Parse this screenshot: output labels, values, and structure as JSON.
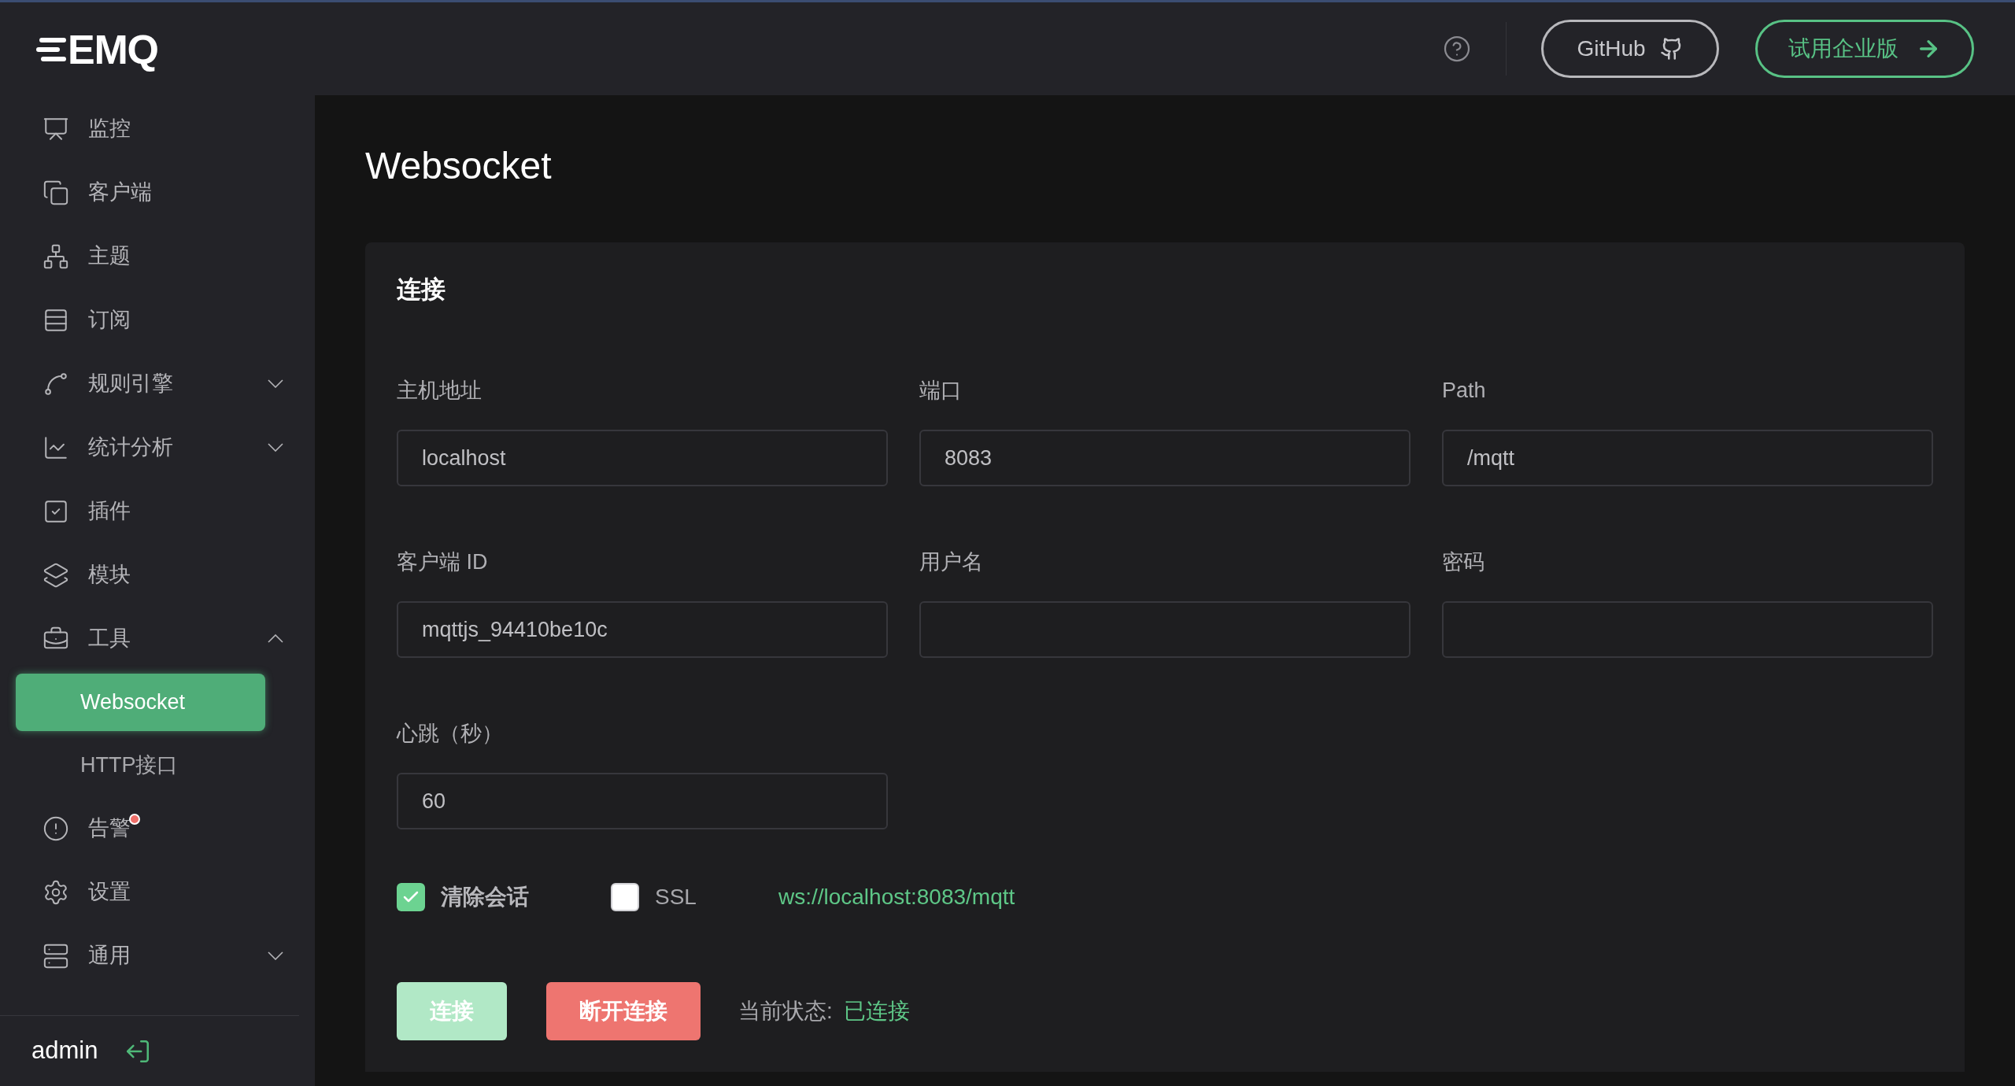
{
  "sidebar": {
    "logo": "EMQ",
    "items": [
      {
        "kind": "item",
        "label": "监控"
      },
      {
        "kind": "item",
        "label": "客户端"
      },
      {
        "kind": "item",
        "label": "主题"
      },
      {
        "kind": "item",
        "label": "订阅"
      },
      {
        "kind": "group",
        "label": "规则引擎",
        "expanded": false
      },
      {
        "kind": "group",
        "label": "统计分析",
        "expanded": false
      },
      {
        "kind": "item",
        "label": "插件"
      },
      {
        "kind": "item",
        "label": "模块"
      },
      {
        "kind": "group",
        "label": "工具",
        "expanded": true,
        "children": [
          {
            "label": "Websocket",
            "selected": true
          },
          {
            "label": "HTTP接口",
            "selected": false
          }
        ]
      },
      {
        "kind": "item",
        "label": "告警",
        "has_alert": true
      },
      {
        "kind": "item",
        "label": "设置"
      },
      {
        "kind": "group",
        "label": "通用",
        "expanded": false
      }
    ],
    "user": "admin"
  },
  "top_bar": {
    "github": "GitHub",
    "trial": "试用企业版"
  },
  "page_title": "Websocket",
  "card": {
    "title": "连接",
    "fields": [
      {
        "label": "主机地址",
        "value": "localhost"
      },
      {
        "label": "端口",
        "value": "8083"
      },
      {
        "label": "Path",
        "value": "/mqtt"
      },
      {
        "label": "客户端 ID",
        "value": "mqttjs_94410be10c"
      },
      {
        "label": "用户名"
      },
      {
        "label": "密码"
      },
      {
        "label": "心跳（秒）",
        "value": "60"
      }
    ],
    "checkboxes": [
      {
        "label": "清除会话",
        "checked": true
      },
      {
        "label": "SSL",
        "checked": false
      }
    ],
    "url": "ws://localhost:8083/mqtt",
    "buttons": [
      {
        "label": "连接",
        "kind": "primary",
        "disabled": true
      },
      {
        "label": "断开连接",
        "kind": "danger",
        "disabled": false
      }
    ],
    "status_label": "当前状态:",
    "status_value": "已连接"
  }
}
